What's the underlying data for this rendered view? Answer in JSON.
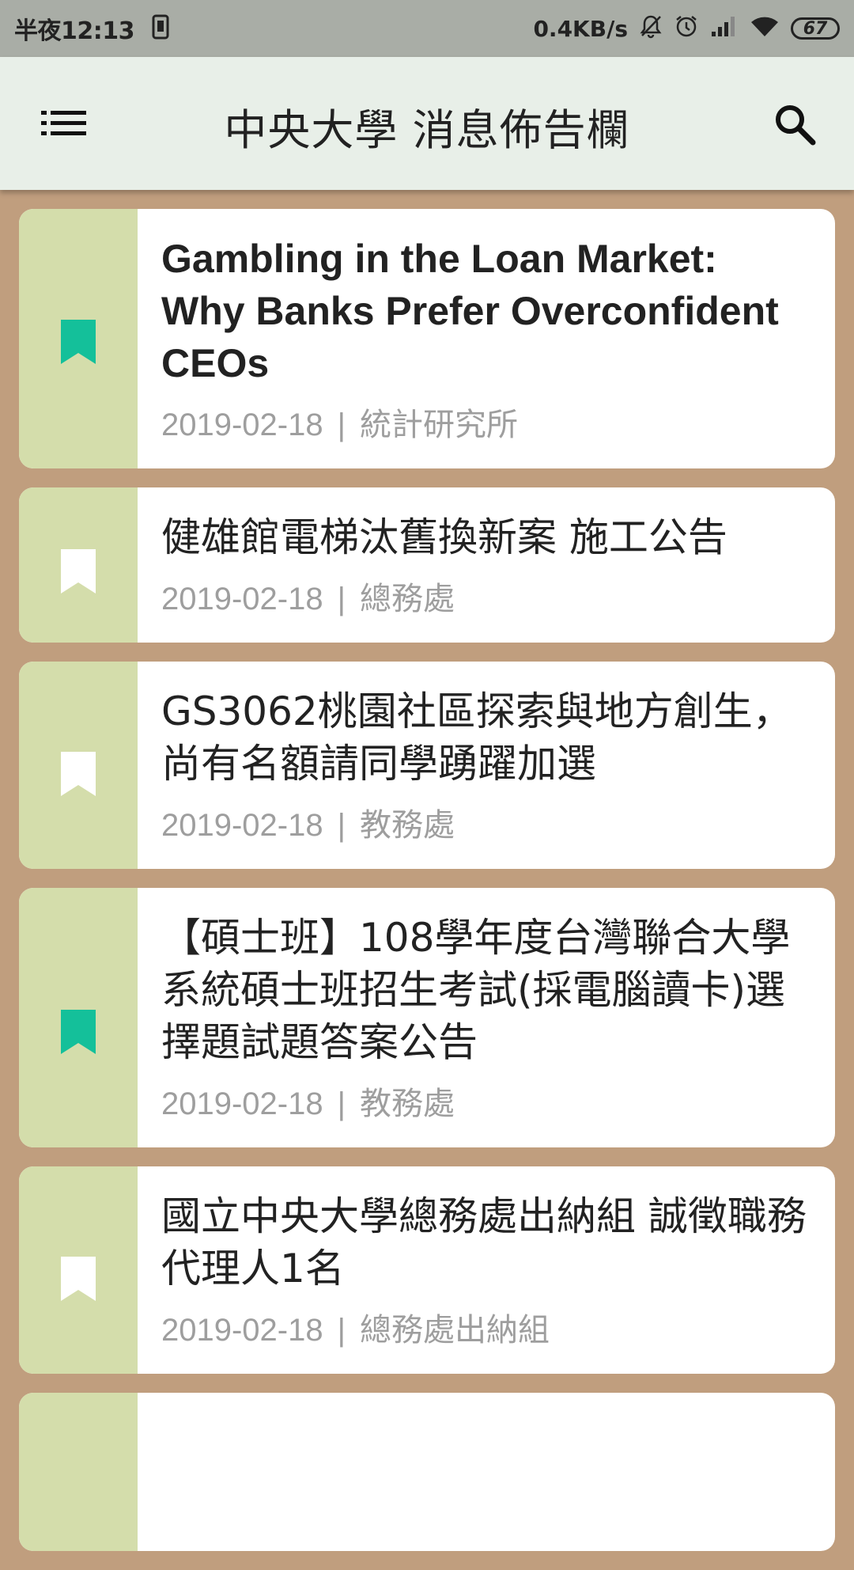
{
  "status_bar": {
    "time": "半夜12:13",
    "speed": "0.4KB/s",
    "battery": "67"
  },
  "app_bar": {
    "title": "中央大學 消息佈告欄"
  },
  "colors": {
    "bookmark_active": "#14c09a",
    "bookmark_inactive": "#ffffff",
    "stripe": "#d4ddab",
    "background": "#c09e7e"
  },
  "announcements": [
    {
      "title": "Gambling in the Loan Market: Why Banks Prefer Overconfident CEOs",
      "date": "2019-02-18",
      "department": "統計研究所",
      "bookmarked": true,
      "separator": "|"
    },
    {
      "title": "健雄館電梯汰舊換新案 施工公告",
      "date": "2019-02-18",
      "department": "總務處",
      "bookmarked": false,
      "separator": "|"
    },
    {
      "title": "GS3062桃園社區探索與地方創生，尚有名額請同學踴躍加選",
      "date": "2019-02-18",
      "department": "教務處",
      "bookmarked": false,
      "separator": "|"
    },
    {
      "title": "【碩士班】108學年度台灣聯合大學系統碩士班招生考試(採電腦讀卡)選擇題試題答案公告",
      "date": "2019-02-18",
      "department": "教務處",
      "bookmarked": true,
      "separator": "|"
    },
    {
      "title": "國立中央大學總務處出納組 誠徵職務代理人1名",
      "date": "2019-02-18",
      "department": "總務處出納組",
      "bookmarked": false,
      "separator": "|"
    }
  ]
}
